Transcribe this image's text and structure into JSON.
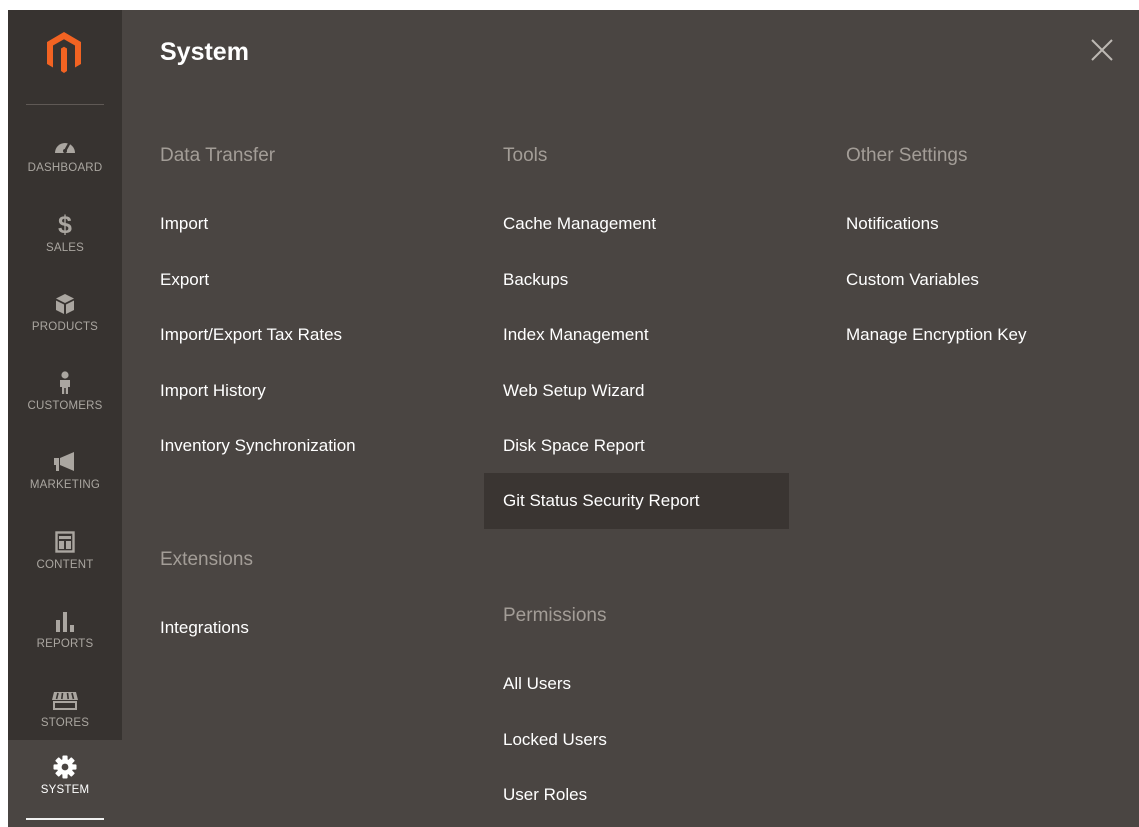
{
  "sidebar": {
    "items": [
      {
        "label": "DASHBOARD",
        "icon": "dashboard-icon"
      },
      {
        "label": "SALES",
        "icon": "dollar-icon"
      },
      {
        "label": "PRODUCTS",
        "icon": "cube-icon"
      },
      {
        "label": "CUSTOMERS",
        "icon": "person-icon"
      },
      {
        "label": "MARKETING",
        "icon": "megaphone-icon"
      },
      {
        "label": "CONTENT",
        "icon": "layout-icon"
      },
      {
        "label": "REPORTS",
        "icon": "bar-chart-icon"
      },
      {
        "label": "STORES",
        "icon": "storefront-icon"
      },
      {
        "label": "SYSTEM",
        "icon": "gear-icon",
        "active": true
      }
    ]
  },
  "panel": {
    "title": "System",
    "colors": {
      "background": "#4a4542",
      "sidebar": "#373330",
      "logo": "#f26322",
      "highlight": "#3a3532"
    },
    "groups": {
      "data_transfer": {
        "title": "Data Transfer",
        "items": [
          "Import",
          "Export",
          "Import/Export Tax Rates",
          "Import History",
          "Inventory Synchronization"
        ]
      },
      "extensions": {
        "title": "Extensions",
        "items": [
          "Integrations"
        ]
      },
      "tools": {
        "title": "Tools",
        "items": [
          "Cache Management",
          "Backups",
          "Index Management",
          "Web Setup Wizard",
          "Disk Space Report",
          "Git Status Security Report"
        ],
        "highlighted": "Git Status Security Report"
      },
      "permissions": {
        "title": "Permissions",
        "items": [
          "All Users",
          "Locked Users",
          "User Roles"
        ]
      },
      "other_settings": {
        "title": "Other Settings",
        "items": [
          "Notifications",
          "Custom Variables",
          "Manage Encryption Key"
        ]
      }
    }
  }
}
